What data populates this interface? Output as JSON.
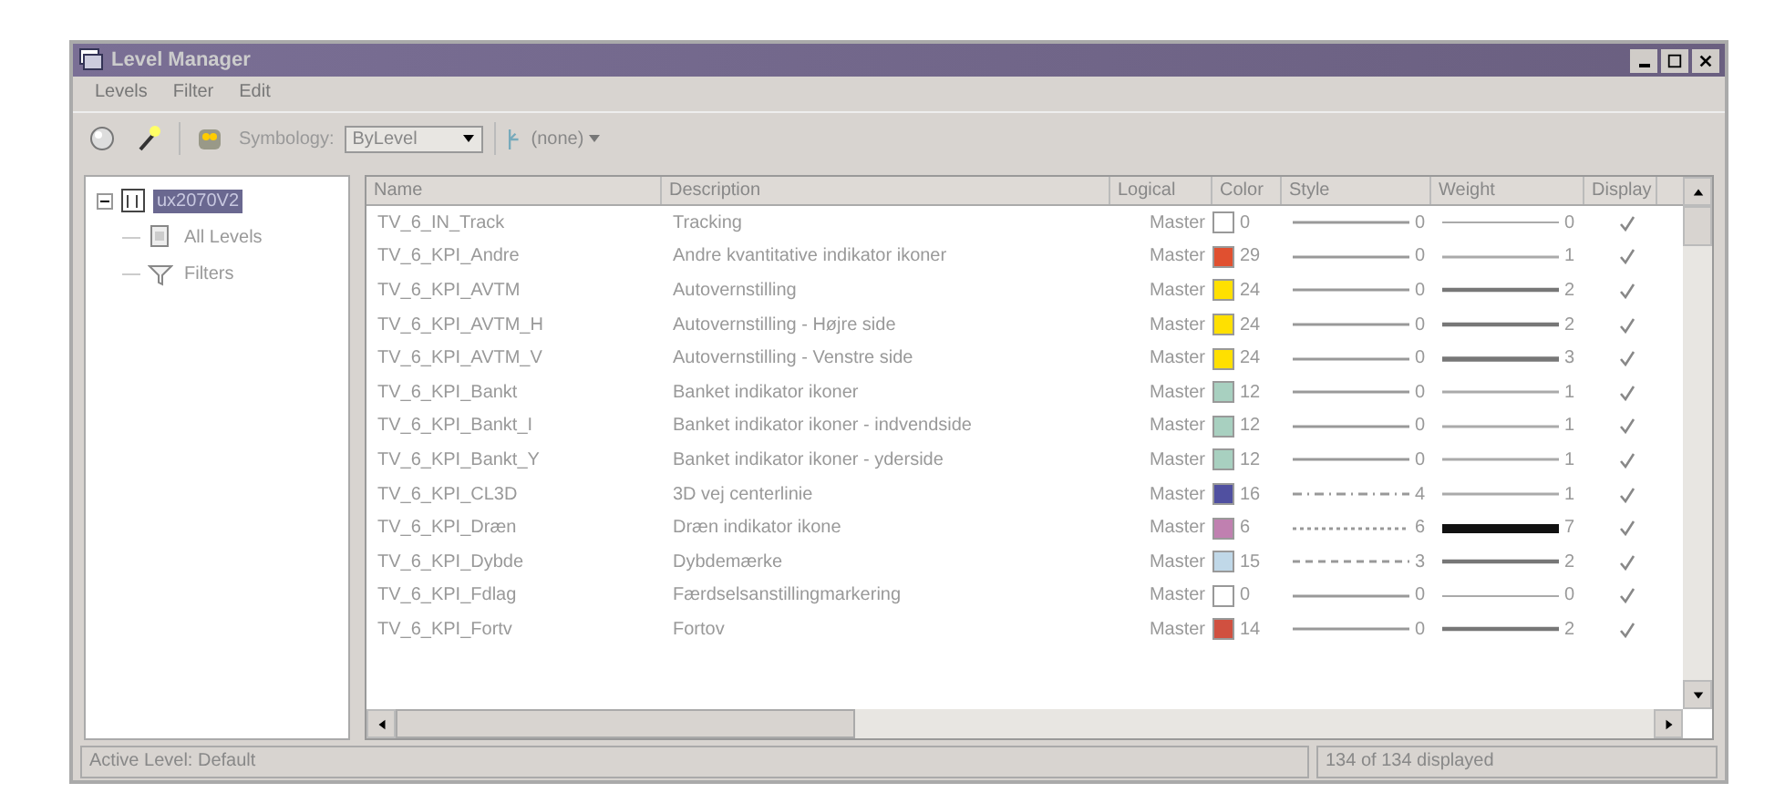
{
  "window": {
    "title": "Level Manager"
  },
  "menu": [
    "Levels",
    "Filter",
    "Edit"
  ],
  "toolbar": {
    "symbology_label": "Symbology:",
    "symbology_value": "ByLevel",
    "filter_value": "(none)"
  },
  "tree": [
    {
      "label": "ux2070V2",
      "selected": true,
      "expanded": true,
      "children": [
        {
          "label": "All Levels",
          "selected": false
        },
        {
          "label": "Filters",
          "selected": false
        }
      ]
    }
  ],
  "table": {
    "columns": [
      "Name",
      "Description",
      "Logical",
      "Color",
      "Style",
      "Weight",
      "Display"
    ],
    "rows": [
      {
        "name": "TV_6_IN_Track",
        "description": "Tracking",
        "logical": "Master",
        "color": "#ffffff",
        "color_number": "0",
        "style": "0",
        "weight": "0",
        "displayed": true
      },
      {
        "name": "TV_6_KPI_Andre",
        "description": "Andre kvantitative indikator ikoner",
        "logical": "Master",
        "color": "#e05030",
        "color_number": "29",
        "style": "0",
        "weight": "1",
        "displayed": true
      },
      {
        "name": "TV_6_KPI_AVTM",
        "description": "Autovernstilling",
        "logical": "Master",
        "color": "#ffe000",
        "color_number": "24",
        "style": "0",
        "weight": "2",
        "displayed": true
      },
      {
        "name": "TV_6_KPI_AVTM_H",
        "description": "Autovernstilling - Højre side",
        "logical": "Master",
        "color": "#ffe000",
        "color_number": "24",
        "style": "0",
        "weight": "2",
        "displayed": true
      },
      {
        "name": "TV_6_KPI_AVTM_V",
        "description": "Autovernstilling - Venstre side",
        "logical": "Master",
        "color": "#ffe000",
        "color_number": "24",
        "style": "0",
        "weight": "3",
        "displayed": true
      },
      {
        "name": "TV_6_KPI_Bankt",
        "description": "Banket indikator ikoner",
        "logical": "Master",
        "color": "#a8d0c0",
        "color_number": "12",
        "style": "0",
        "weight": "1",
        "displayed": true
      },
      {
        "name": "TV_6_KPI_Bankt_I",
        "description": "Banket indikator ikoner - indvendside",
        "logical": "Master",
        "color": "#a8d0c0",
        "color_number": "12",
        "style": "0",
        "weight": "1",
        "displayed": true
      },
      {
        "name": "TV_6_KPI_Bankt_Y",
        "description": "Banket indikator ikoner - yderside",
        "logical": "Master",
        "color": "#a8d0c0",
        "color_number": "12",
        "style": "0",
        "weight": "1",
        "displayed": true
      },
      {
        "name": "TV_6_KPI_CL3D",
        "description": "3D vej centerlinie",
        "logical": "Master",
        "color": "#5050a0",
        "color_number": "16",
        "style": "4",
        "weight": "1",
        "displayed": true
      },
      {
        "name": "TV_6_KPI_Dræn",
        "description": "Dræn indikator ikone",
        "logical": "Master",
        "color": "#c080b0",
        "color_number": "6",
        "style": "6",
        "weight": "7",
        "displayed": true
      },
      {
        "name": "TV_6_KPI_Dybde",
        "description": "Dybdemærke",
        "logical": "Master",
        "color": "#c0d8e8",
        "color_number": "15",
        "style": "3",
        "weight": "2",
        "displayed": true
      },
      {
        "name": "TV_6_KPI_Fdlag",
        "description": "Færdselsanstillingmarkering",
        "logical": "Master",
        "color": "#ffffff",
        "color_number": "0",
        "style": "0",
        "weight": "0",
        "displayed": true
      },
      {
        "name": "TV_6_KPI_Fortv",
        "description": "Fortov",
        "logical": "Master",
        "color": "#d05040",
        "color_number": "14",
        "style": "0",
        "weight": "2",
        "displayed": true
      }
    ]
  },
  "status_bar": {
    "active_level": "Active Level: Default",
    "count": "134 of 134 displayed"
  }
}
